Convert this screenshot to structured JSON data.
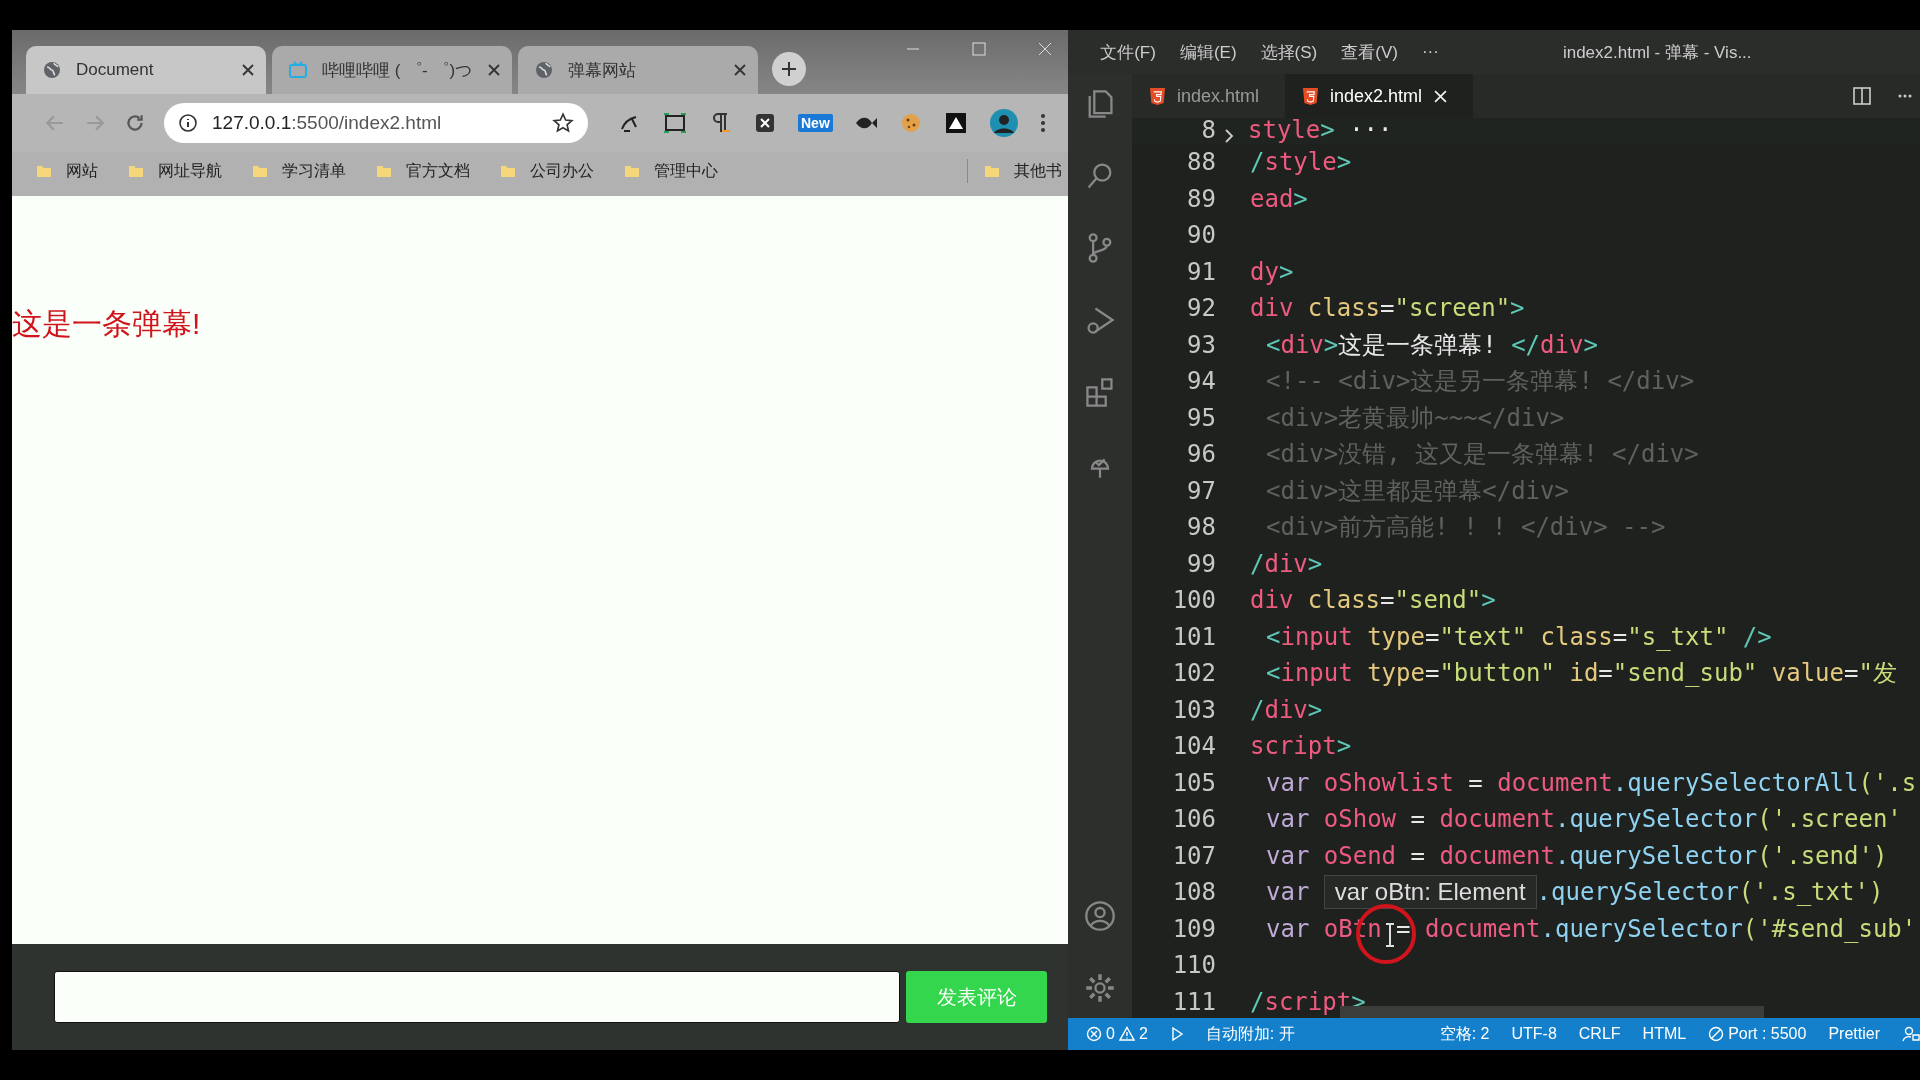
{
  "browser": {
    "tabs": [
      {
        "title": "Document",
        "kind": "site",
        "selected": true
      },
      {
        "title": "哔哩哔哩 ( ゜- ゜)つ",
        "kind": "video",
        "selected": false
      },
      {
        "title": "弹幕网站",
        "kind": "site",
        "selected": false
      }
    ],
    "address": {
      "host": "127.0.0.1",
      "path": ":5500/index2.html"
    },
    "extension_badge": "New",
    "bookmarks": [
      "网站",
      "网址导航",
      "学习清单",
      "官方文档",
      "公司办公",
      "管理中心"
    ],
    "other_bookmarks": "其他书",
    "page": {
      "danmaku": [
        "这是一条弹幕!"
      ],
      "send_button": "发表评论"
    }
  },
  "editor": {
    "window_title": "index2.html - 弹幕 - Vis...",
    "menu": [
      "文件(F)",
      "编辑(E)",
      "选择(S)",
      "查看(V)",
      "···"
    ],
    "tabs": [
      {
        "title": "index.html",
        "selected": false
      },
      {
        "title": "index2.html",
        "selected": true
      }
    ],
    "sticky_line": {
      "number": "8",
      "tokens": [
        {
          "text": "style",
          "kind": "tag"
        },
        {
          "text": ">",
          "kind": "bracket"
        },
        {
          "text": " ···",
          "kind": "plain"
        }
      ]
    },
    "lines": [
      {
        "number": "88",
        "tokens": [
          {
            "text": "/",
            "kind": "bracket"
          },
          {
            "text": "style",
            "kind": "tag"
          },
          {
            "text": ">",
            "kind": "bracket"
          }
        ]
      },
      {
        "number": "89",
        "tokens": [
          {
            "text": "ead",
            "kind": "tag"
          },
          {
            "text": ">",
            "kind": "bracket"
          }
        ]
      },
      {
        "number": "90"
      },
      {
        "number": "91",
        "tokens": [
          {
            "text": "dy",
            "kind": "tag"
          },
          {
            "text": ">",
            "kind": "bracket"
          }
        ]
      },
      {
        "number": "92",
        "tokens": [
          {
            "text": "div ",
            "kind": "tag"
          },
          {
            "text": "class",
            "kind": "attr"
          },
          {
            "text": "=",
            "kind": "plain"
          },
          {
            "text": "\"screen\"",
            "kind": "string"
          },
          {
            "text": ">",
            "kind": "bracket"
          }
        ]
      },
      {
        "number": "93",
        "indent": true,
        "tokens": [
          {
            "text": "<",
            "kind": "bracket"
          },
          {
            "text": "div",
            "kind": "tag"
          },
          {
            "text": ">",
            "kind": "bracket"
          },
          {
            "text": "这是一条弹幕! ",
            "kind": "plain"
          },
          {
            "text": "</",
            "kind": "bracket"
          },
          {
            "text": "div",
            "kind": "tag"
          },
          {
            "text": ">",
            "kind": "bracket"
          }
        ]
      },
      {
        "number": "94",
        "indent": true,
        "tokens": [
          {
            "text": "<!-- <div>这是另一条弹幕! </div>",
            "kind": "comment"
          }
        ]
      },
      {
        "number": "95",
        "indent": true,
        "tokens": [
          {
            "text": "<div>老黄最帅~~~</div>",
            "kind": "comment"
          }
        ]
      },
      {
        "number": "96",
        "indent": true,
        "tokens": [
          {
            "text": "<div>没错, 这又是一条弹幕! </div>",
            "kind": "comment"
          }
        ]
      },
      {
        "number": "97",
        "indent": true,
        "tokens": [
          {
            "text": "<div>这里都是弹幕</div>",
            "kind": "comment"
          }
        ]
      },
      {
        "number": "98",
        "indent": true,
        "tokens": [
          {
            "text": "<div>前方高能! ! ! </div> -->",
            "kind": "comment"
          }
        ]
      },
      {
        "number": "99",
        "tokens": [
          {
            "text": "/",
            "kind": "bracket"
          },
          {
            "text": "div",
            "kind": "tag"
          },
          {
            "text": ">",
            "kind": "bracket"
          }
        ]
      },
      {
        "number": "100",
        "tokens": [
          {
            "text": "div ",
            "kind": "tag"
          },
          {
            "text": "class",
            "kind": "attr"
          },
          {
            "text": "=",
            "kind": "plain"
          },
          {
            "text": "\"send\"",
            "kind": "string"
          },
          {
            "text": ">",
            "kind": "bracket"
          }
        ]
      },
      {
        "number": "101",
        "indent": true,
        "tokens": [
          {
            "text": "<",
            "kind": "bracket"
          },
          {
            "text": "input ",
            "kind": "tag"
          },
          {
            "text": "type",
            "kind": "attr"
          },
          {
            "text": "=",
            "kind": "plain"
          },
          {
            "text": "\"text\" ",
            "kind": "string"
          },
          {
            "text": "class",
            "kind": "attr"
          },
          {
            "text": "=",
            "kind": "plain"
          },
          {
            "text": "\"s_txt\" ",
            "kind": "string"
          },
          {
            "text": "/>",
            "kind": "bracket"
          }
        ]
      },
      {
        "number": "102",
        "indent": true,
        "tokens": [
          {
            "text": "<",
            "kind": "bracket"
          },
          {
            "text": "input ",
            "kind": "tag"
          },
          {
            "text": "type",
            "kind": "attr"
          },
          {
            "text": "=",
            "kind": "plain"
          },
          {
            "text": "\"button\" ",
            "kind": "string"
          },
          {
            "text": "id",
            "kind": "attr"
          },
          {
            "text": "=",
            "kind": "plain"
          },
          {
            "text": "\"send_sub\" ",
            "kind": "string"
          },
          {
            "text": "value",
            "kind": "attr"
          },
          {
            "text": "=",
            "kind": "plain"
          },
          {
            "text": "\"发",
            "kind": "string"
          }
        ]
      },
      {
        "number": "103",
        "tokens": [
          {
            "text": "/",
            "kind": "bracket"
          },
          {
            "text": "div",
            "kind": "tag"
          },
          {
            "text": ">",
            "kind": "bracket"
          }
        ]
      },
      {
        "number": "104",
        "tokens": [
          {
            "text": "script",
            "kind": "tag"
          },
          {
            "text": ">",
            "kind": "bracket"
          }
        ]
      },
      {
        "number": "105",
        "indent": true,
        "tokens": [
          {
            "text": "var ",
            "kind": "keyword"
          },
          {
            "text": "oShowlist ",
            "kind": "variable"
          },
          {
            "text": "= ",
            "kind": "plain"
          },
          {
            "text": "document",
            "kind": "variable"
          },
          {
            "text": ".querySelectorAll",
            "kind": "function"
          },
          {
            "text": "('.s",
            "kind": "string"
          }
        ]
      },
      {
        "number": "106",
        "indent": true,
        "tokens": [
          {
            "text": "var ",
            "kind": "keyword"
          },
          {
            "text": "oShow ",
            "kind": "variable"
          },
          {
            "text": "= ",
            "kind": "plain"
          },
          {
            "text": "document",
            "kind": "variable"
          },
          {
            "text": ".querySelector",
            "kind": "function"
          },
          {
            "text": "('.screen'",
            "kind": "string"
          }
        ]
      },
      {
        "number": "107",
        "indent": true,
        "tokens": [
          {
            "text": "var ",
            "kind": "keyword"
          },
          {
            "text": "oSend ",
            "kind": "variable"
          },
          {
            "text": "= ",
            "kind": "plain"
          },
          {
            "text": "document",
            "kind": "variable"
          },
          {
            "text": ".querySelector",
            "kind": "function"
          },
          {
            "text": "('.send')",
            "kind": "string"
          }
        ]
      },
      {
        "number": "108",
        "indent": true,
        "tooltip": "var oBtn: Element",
        "tokens": [
          {
            "text": "var ",
            "kind": "keyword"
          },
          {
            "text": ".querySelector",
            "kind": "function"
          },
          {
            "text": "('.s_txt')",
            "kind": "string"
          }
        ]
      },
      {
        "number": "109",
        "indent": true,
        "tokens": [
          {
            "text": "var ",
            "kind": "keyword"
          },
          {
            "text": "oBtn ",
            "kind": "variable"
          },
          {
            "text": "= ",
            "kind": "plain"
          },
          {
            "text": "document",
            "kind": "variable"
          },
          {
            "text": ".querySelector",
            "kind": "function"
          },
          {
            "text": "('#send_sub'",
            "kind": "string"
          }
        ]
      },
      {
        "number": "110"
      },
      {
        "number": "111",
        "tokens": [
          {
            "text": "/",
            "kind": "bracket"
          },
          {
            "text": "script",
            "kind": "tag"
          },
          {
            "text": ">",
            "kind": "bracket"
          }
        ]
      }
    ],
    "status": {
      "errors": "0",
      "warnings": "2",
      "auto_attach": "自动附加: 开",
      "items": [
        "空格: 2",
        "UTF-8",
        "CRLF",
        "HTML"
      ],
      "port": "Port : 5500",
      "formatter": "Prettier"
    }
  }
}
